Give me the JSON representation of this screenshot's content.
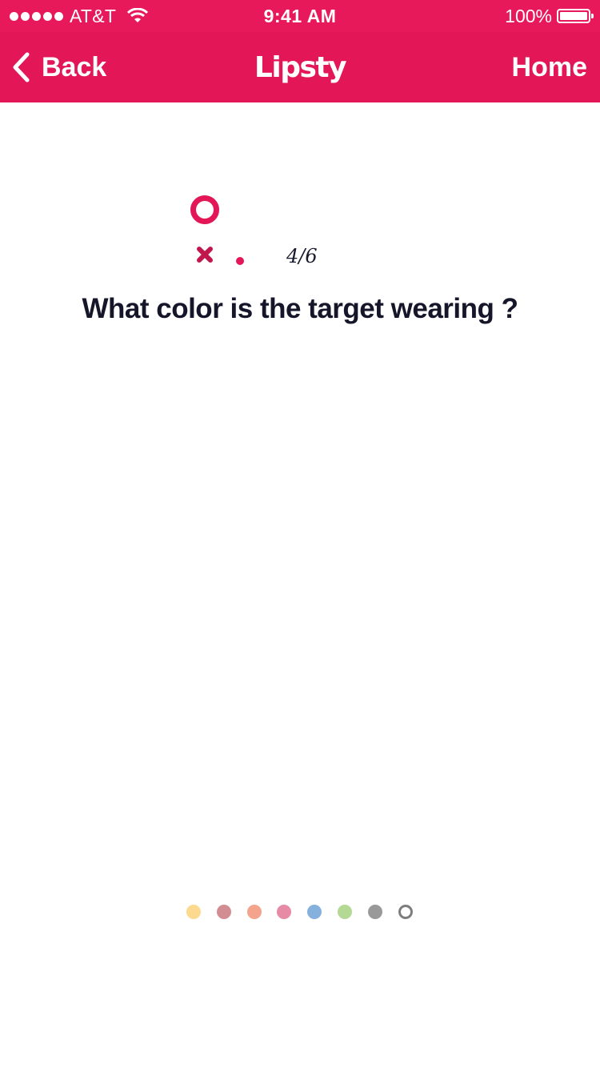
{
  "status_bar": {
    "carrier": "AT&T",
    "time": "9:41 AM",
    "battery": "100%",
    "signal_icon": "signal-dots-icon",
    "wifi_icon": "wifi-icon",
    "battery_icon": "battery-icon"
  },
  "nav": {
    "back_label": "Back",
    "title": "Lipsty",
    "home_label": "Home",
    "back_icon": "chevron-left-icon"
  },
  "progress": {
    "counter": "4/6",
    "current": 4,
    "total": 6,
    "icons": [
      "ring-icon",
      "x-icon",
      "dot-icon"
    ]
  },
  "question": "What color is the target wearing ?",
  "color_options": [
    {
      "name": "yellow",
      "color": "#fcd98e"
    },
    {
      "name": "mauve",
      "color": "#d18d92"
    },
    {
      "name": "peach",
      "color": "#f4a48c"
    },
    {
      "name": "pink",
      "color": "#e68aa6"
    },
    {
      "name": "blue",
      "color": "#86b1dc"
    },
    {
      "name": "green",
      "color": "#b4d994"
    },
    {
      "name": "gray",
      "color": "#999999"
    },
    {
      "name": "white",
      "color": "#ffffff",
      "outline": true
    }
  ],
  "colors": {
    "brand": "#e31658",
    "status_bar": "#e8195a",
    "text_dark": "#16162a"
  }
}
